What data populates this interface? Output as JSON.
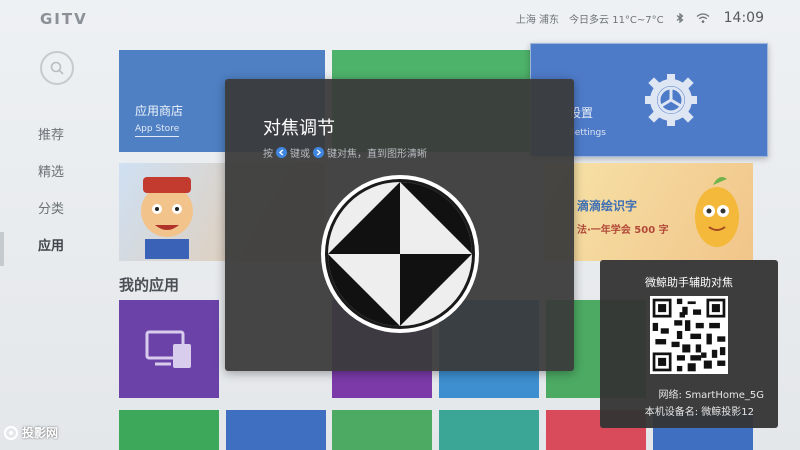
{
  "header": {
    "logo": "GITV",
    "location": "上海 浦东",
    "weather": "今日多云 11°C~7°C",
    "time": "14:09"
  },
  "nav": {
    "items": [
      {
        "label": "推荐"
      },
      {
        "label": "精选"
      },
      {
        "label": "分类"
      },
      {
        "label": "应用"
      }
    ],
    "active": "应用"
  },
  "tiles": {
    "store_label": "应用商店",
    "store_sub": "App Store",
    "settings_label": "设置",
    "settings_sub": "Settings",
    "banner2_title": "滴滴绘识字",
    "banner2_sub": "法·一年学会 500 字"
  },
  "section_title": "我的应用",
  "focus_dialog": {
    "title": "对焦调节",
    "hint_press": "按",
    "hint_mid": "键或",
    "hint_end": "键对焦，直到图形清晰"
  },
  "qr_panel": {
    "title": "微鲸助手辅助对焦",
    "network": "网络: SmartHome_5G",
    "device": "本机设备名: 微鲸投影12"
  },
  "watermark": "投影网",
  "colors": {
    "dialog_bg": "#3a3a3a",
    "key_blue": "#3f86e0",
    "store_tile": "#4f80c4",
    "settings_tile": "#4e7bc8"
  }
}
